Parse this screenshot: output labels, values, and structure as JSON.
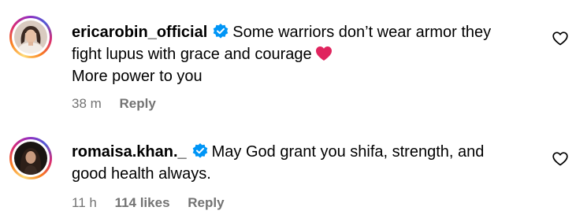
{
  "comments": [
    {
      "username": "ericarobin_official",
      "verified": true,
      "text_line1": "Some warriors don’t wear armor they",
      "text_line2": "fight lupus with grace and courage",
      "text_line3": "More power to you",
      "emoji": "red-heart",
      "time": "38 m",
      "reply_label": "Reply",
      "like_icon": "heart-outline-icon"
    },
    {
      "username": "romaisa.khan._",
      "verified": true,
      "text_line1": "May God grant you shifa, strength, and",
      "text_line2": "good health always.",
      "time": "11 h",
      "likes": "114 likes",
      "reply_label": "Reply",
      "like_icon": "heart-outline-icon"
    }
  ],
  "colors": {
    "verified_blue": "#0095f6",
    "meta_gray": "#737373",
    "heart_red": "#e0245e"
  }
}
